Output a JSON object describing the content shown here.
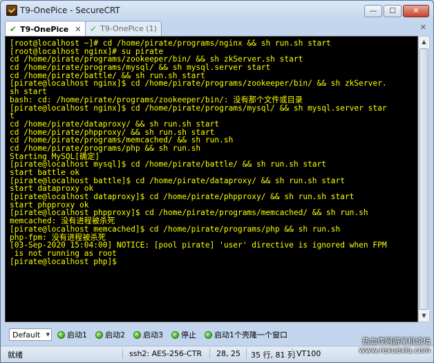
{
  "window": {
    "title": "T9-OnePice - SecureCRT"
  },
  "window_controls": {
    "minimize": "—",
    "maximize": "☐",
    "close": "✕"
  },
  "tabs": [
    {
      "label": "T9-OnePice",
      "active": true,
      "close": "✕"
    },
    {
      "label": "T9-OnePice (1)",
      "active": false
    }
  ],
  "tab_close_all": "✕",
  "terminal": {
    "lines": [
      "[root@localhost ~]# cd /home/pirate/programs/nginx && sh run.sh start",
      "[root@localhost nginx]# su pirate",
      "cd /home/pirate/programs/zookeeper/bin/ && sh zkServer.sh start",
      "cd /home/pirate/programs/mysql/ && sh mysql.server start",
      "cd /home/pirate/battle/ && sh run.sh start",
      "[pirate@localhost nginx]$ cd /home/pirate/programs/zookeeper/bin/ && sh zkServer.",
      "sh start",
      "bash: cd: /home/pirate/programs/zookeeper/bin/: 没有那个文件或目录",
      "[pirate@localhost nginx]$ cd /home/pirate/programs/mysql/ && sh mysql.server star",
      "t",
      "cd /home/pirate/dataproxy/ && sh run.sh start",
      "cd /home/pirate/phpproxy/ && sh run.sh start",
      "cd /home/pirate/programs/memcached/ && sh run.sh",
      "cd /home/pirate/programs/php && sh run.sh",
      "Starting MySQL[确定]",
      "[pirate@localhost mysql]$ cd /home/pirate/battle/ && sh run.sh start",
      "start battle ok",
      "[pirate@localhost battle]$ cd /home/pirate/dataproxy/ && sh run.sh start",
      "start dataproxy ok",
      "[pirate@localhost dataproxy]$ cd /home/pirate/phpproxy/ && sh run.sh start",
      "start phpproxy ok",
      "[pirate@localhost phpproxy]$ cd /home/pirate/programs/memcached/ && sh run.sh",
      "memcached: 没有进程被杀死",
      "[pirate@localhost memcached]$ cd /home/pirate/programs/php && sh run.sh",
      "php-fpm: 没有进程被杀死",
      "[03-Sep-2020 15:04:00] NOTICE: [pool pirate] 'user' directive is ignored when FPM",
      " is not running as root",
      "[pirate@localhost php]$ "
    ],
    "text_color": "#ffff00",
    "background_color": "#000000"
  },
  "scrollbar": {
    "up": "▲",
    "down": "▼"
  },
  "button_bar": {
    "session": "Default",
    "dropdown_arrow": "▼",
    "buttons": [
      "启动1",
      "启动2",
      "启动3",
      "停止",
      "启动1个壳隆一个窗口"
    ]
  },
  "status_bar": {
    "ready": "就绪",
    "cipher": "ssh2: AES-256-CTR",
    "cursor": "28, 25",
    "rows_cols": "35 行, 81 列",
    "terminal_type": "VT100"
  },
  "watermark": {
    "line1": "热血传网游单机论坛",
    "line2": "www.rexuexia.com"
  }
}
